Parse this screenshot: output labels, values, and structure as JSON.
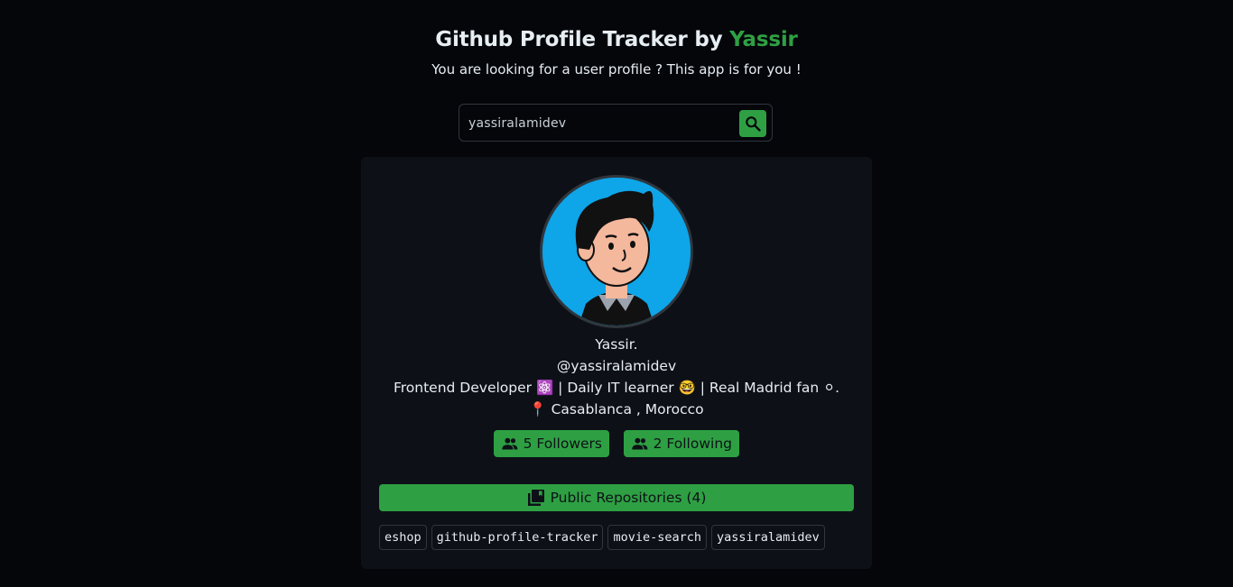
{
  "header": {
    "title_prefix": "Github Profile Tracker by ",
    "title_accent": "Yassir",
    "subtitle": "You are looking for a user profile ? This app is for you !"
  },
  "search": {
    "value": "yassiralamidev",
    "button_icon": "search-icon"
  },
  "profile": {
    "avatar_icon": "avatar-cartoon",
    "name": "Yassir.",
    "login": "@yassiralamidev",
    "bio": "Frontend Developer ⚛️ | Daily IT learner 🤓 | Real Madrid fan ⚪.",
    "location": "📍 Casablanca , Morocco",
    "followers_label": "5 Followers",
    "following_label": "2 Following"
  },
  "repositories": {
    "header": "Public Repositories (4)",
    "items": [
      "eshop",
      "github-profile-tracker",
      "movie-search",
      "yassiralamidev"
    ]
  },
  "colors": {
    "accent": "#2ea043",
    "background": "#04060a",
    "card": "#0d1117",
    "avatar_bg": "#0ea5e9"
  }
}
